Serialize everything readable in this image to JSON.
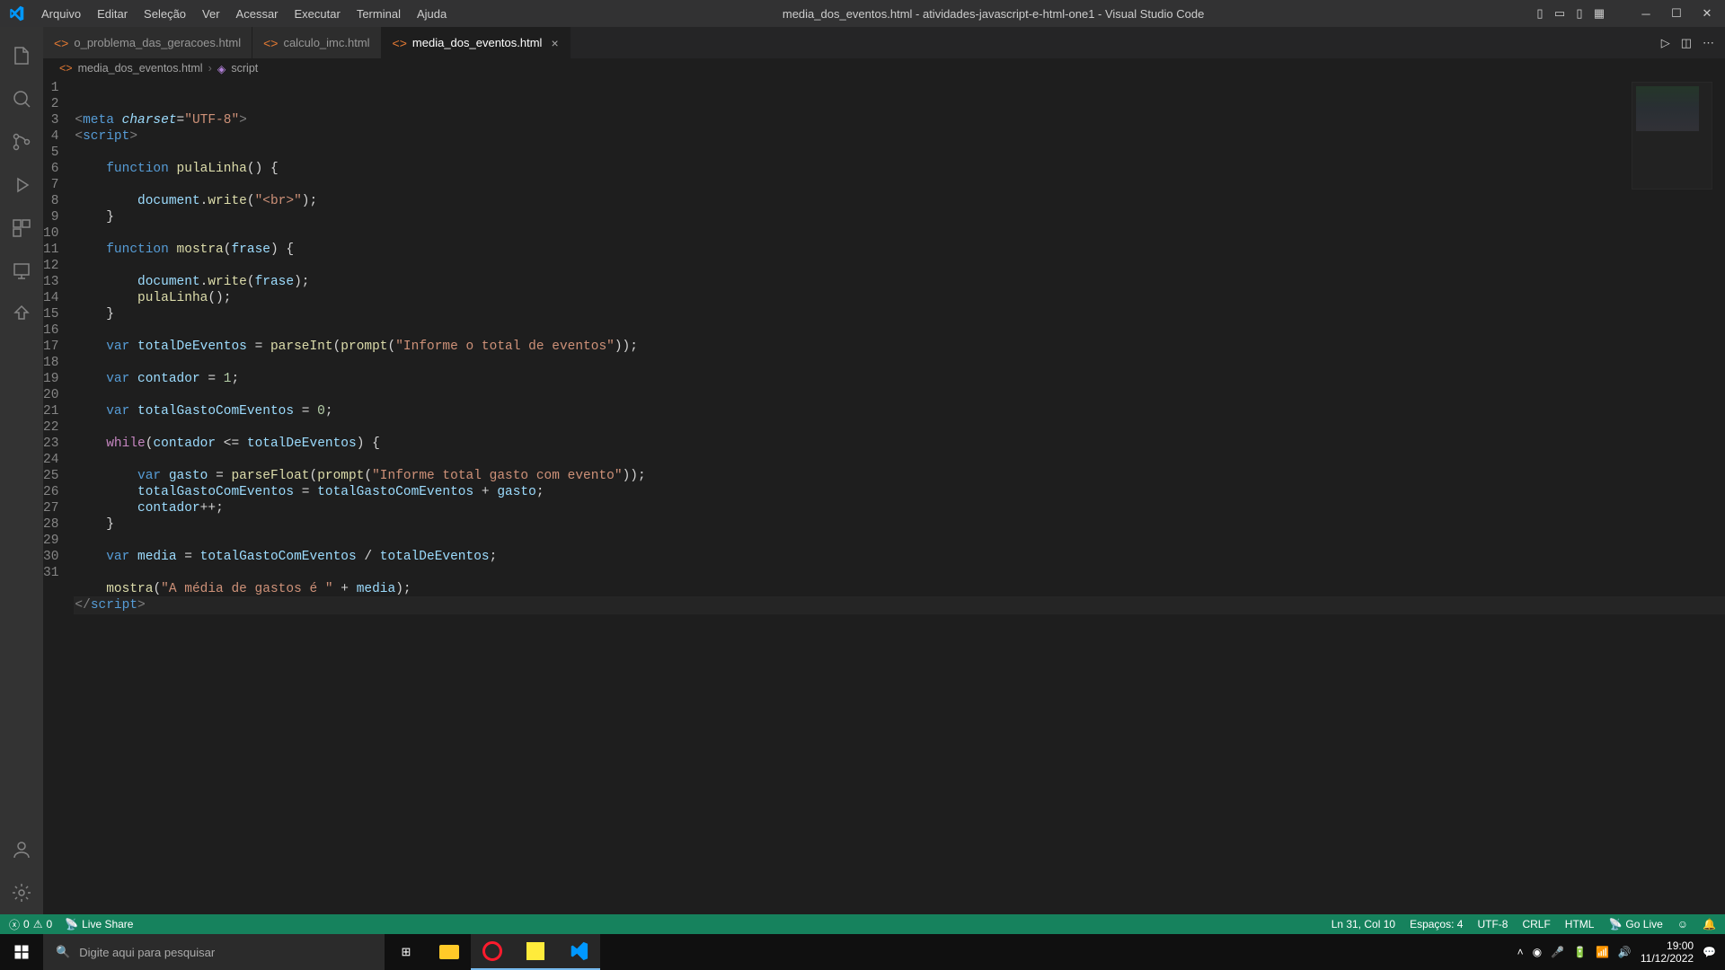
{
  "window": {
    "title": "media_dos_eventos.html - atividades-javascript-e-html-one1 - Visual Studio Code"
  },
  "menus": [
    "Arquivo",
    "Editar",
    "Seleção",
    "Ver",
    "Acessar",
    "Executar",
    "Terminal",
    "Ajuda"
  ],
  "tabs": [
    {
      "label": "o_problema_das_geracoes.html",
      "active": false
    },
    {
      "label": "calculo_imc.html",
      "active": false
    },
    {
      "label": "media_dos_eventos.html",
      "active": true
    }
  ],
  "breadcrumb": {
    "file": "media_dos_eventos.html",
    "symbol": "script"
  },
  "status": {
    "errors": "0",
    "warnings": "0",
    "live_share": "Live Share",
    "ln_col": "Ln 31, Col 10",
    "spaces": "Espaços: 4",
    "encoding": "UTF-8",
    "eol": "CRLF",
    "lang": "HTML",
    "golive": "Go Live"
  },
  "taskbar": {
    "search_placeholder": "Digite aqui para pesquisar",
    "time": "19:00",
    "date": "11/12/2022"
  },
  "code_lines": [
    {
      "n": 1,
      "html": "<span class='tk-gray'>&lt;</span><span class='tk-tag'>meta</span> <span class='tk-attr'>charset</span><span class='tk-op'>=</span><span class='tk-str'>\"UTF-8\"</span><span class='tk-gray'>&gt;</span>"
    },
    {
      "n": 2,
      "html": "<span class='tk-gray'>&lt;</span><span class='tk-tag'>script</span><span class='tk-gray'>&gt;</span>"
    },
    {
      "n": 3,
      "html": ""
    },
    {
      "n": 4,
      "html": "    <span class='tk-kw'>function</span> <span class='tk-fn'>pulaLinha</span>() {"
    },
    {
      "n": 5,
      "html": ""
    },
    {
      "n": 6,
      "html": "        <span class='tk-var'>document</span>.<span class='tk-call'>write</span>(<span class='tk-str'>\"&lt;br&gt;\"</span>);"
    },
    {
      "n": 7,
      "html": "    }"
    },
    {
      "n": 8,
      "html": ""
    },
    {
      "n": 9,
      "html": "    <span class='tk-kw'>function</span> <span class='tk-fn'>mostra</span>(<span class='tk-var'>frase</span>) {"
    },
    {
      "n": 10,
      "html": ""
    },
    {
      "n": 11,
      "html": "        <span class='tk-var'>document</span>.<span class='tk-call'>write</span>(<span class='tk-var'>frase</span>);"
    },
    {
      "n": 12,
      "html": "        <span class='tk-call'>pulaLinha</span>();"
    },
    {
      "n": 13,
      "html": "    }"
    },
    {
      "n": 14,
      "html": ""
    },
    {
      "n": 15,
      "html": "    <span class='tk-kw'>var</span> <span class='tk-var'>totalDeEventos</span> <span class='tk-op'>=</span> <span class='tk-call'>parseInt</span>(<span class='tk-call'>prompt</span>(<span class='tk-str'>\"Informe o total de eventos\"</span>));"
    },
    {
      "n": 16,
      "html": ""
    },
    {
      "n": 17,
      "html": "    <span class='tk-kw'>var</span> <span class='tk-var'>contador</span> <span class='tk-op'>=</span> <span class='tk-num'>1</span>;"
    },
    {
      "n": 18,
      "html": ""
    },
    {
      "n": 19,
      "html": "    <span class='tk-kw'>var</span> <span class='tk-var'>totalGastoComEventos</span> <span class='tk-op'>=</span> <span class='tk-num'>0</span>;"
    },
    {
      "n": 20,
      "html": ""
    },
    {
      "n": 21,
      "html": "    <span class='tk-kw2'>while</span>(<span class='tk-var'>contador</span> <span class='tk-op'>&lt;=</span> <span class='tk-var'>totalDeEventos</span>) {"
    },
    {
      "n": 22,
      "html": ""
    },
    {
      "n": 23,
      "html": "        <span class='tk-kw'>var</span> <span class='tk-var'>gasto</span> <span class='tk-op'>=</span> <span class='tk-call'>parseFloat</span>(<span class='tk-call'>prompt</span>(<span class='tk-str'>\"Informe total gasto com evento\"</span>));"
    },
    {
      "n": 24,
      "html": "        <span class='tk-var'>totalGastoComEventos</span> <span class='tk-op'>=</span> <span class='tk-var'>totalGastoComEventos</span> <span class='tk-op'>+</span> <span class='tk-var'>gasto</span>;"
    },
    {
      "n": 25,
      "html": "        <span class='tk-var'>contador</span><span class='tk-op'>++</span>;"
    },
    {
      "n": 26,
      "html": "    }"
    },
    {
      "n": 27,
      "html": ""
    },
    {
      "n": 28,
      "html": "    <span class='tk-kw'>var</span> <span class='tk-var'>media</span> <span class='tk-op'>=</span> <span class='tk-var'>totalGastoComEventos</span> <span class='tk-op'>/</span> <span class='tk-var'>totalDeEventos</span>;"
    },
    {
      "n": 29,
      "html": ""
    },
    {
      "n": 30,
      "html": "    <span class='tk-call'>mostra</span>(<span class='tk-str'>\"A média de gastos é \"</span> <span class='tk-op'>+</span> <span class='tk-var'>media</span>);"
    },
    {
      "n": 31,
      "html": "<span class='tk-gray'>&lt;/</span><span class='tk-tag'>script</span><span class='tk-gray'>&gt;</span>",
      "current": true
    }
  ]
}
